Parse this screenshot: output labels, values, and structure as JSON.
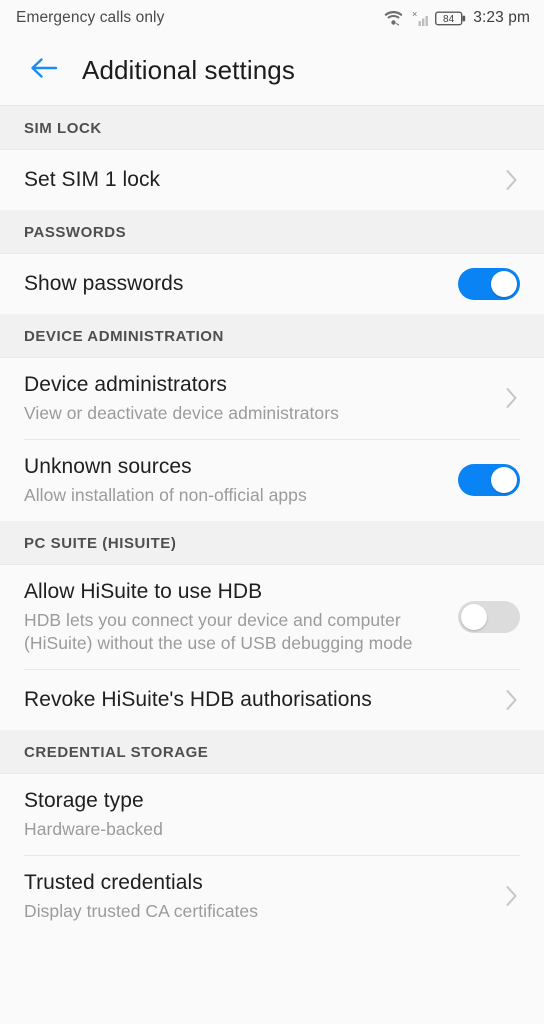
{
  "status_bar": {
    "carrier_text": "Emergency calls only",
    "time": "3:23 pm",
    "battery_level": "84",
    "icons": [
      "wifi-icon",
      "signal-bars-no-service-icon",
      "battery-icon"
    ]
  },
  "app_bar": {
    "back_label": "back-arrow",
    "title": "Additional settings"
  },
  "accent_color": "#0a84f5",
  "sections": [
    {
      "header": "SIM LOCK",
      "rows": [
        {
          "title": "Set SIM 1 lock",
          "subtitle": "",
          "control": "chevron"
        }
      ]
    },
    {
      "header": "PASSWORDS",
      "rows": [
        {
          "title": "Show passwords",
          "subtitle": "",
          "control": "switch",
          "switch_state": "on"
        }
      ]
    },
    {
      "header": "DEVICE ADMINISTRATION",
      "rows": [
        {
          "title": "Device administrators",
          "subtitle": "View or deactivate device administrators",
          "control": "chevron"
        },
        {
          "title": "Unknown sources",
          "subtitle": "Allow installation of non-official apps",
          "control": "switch",
          "switch_state": "on"
        }
      ]
    },
    {
      "header": "PC SUITE (HISUITE)",
      "rows": [
        {
          "title": "Allow HiSuite to use HDB",
          "subtitle": "HDB lets you connect your device and computer (HiSuite) without the use of USB debugging mode",
          "control": "switch",
          "switch_state": "off"
        },
        {
          "title": "Revoke HiSuite's HDB authorisations",
          "subtitle": "",
          "control": "chevron"
        }
      ]
    },
    {
      "header": "CREDENTIAL STORAGE",
      "rows": [
        {
          "title": "Storage type",
          "subtitle": "Hardware-backed",
          "control": "none"
        },
        {
          "title": "Trusted credentials",
          "subtitle": "Display trusted CA certificates",
          "control": "chevron"
        }
      ]
    }
  ]
}
